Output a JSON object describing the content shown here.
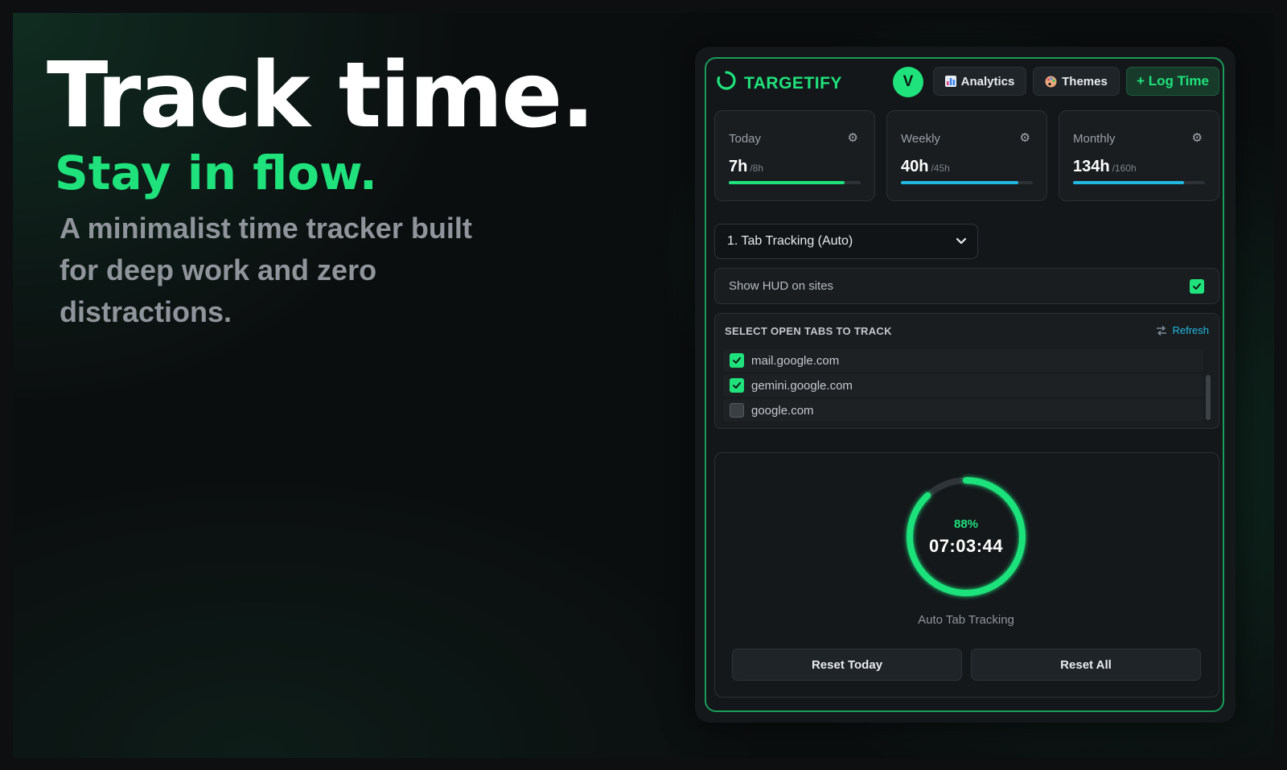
{
  "hero": {
    "title": "Track time.",
    "subtitle": "Stay in flow.",
    "description": "A minimalist time tracker built for deep work and zero distractions."
  },
  "header": {
    "brand": "TARGETIFY",
    "avatar_initial": "V",
    "analytics_label": "Analytics",
    "analytics_icon": "bar-chart-icon",
    "themes_label": "Themes",
    "themes_icon": "palette-icon",
    "log_time_label": "+ Log Time"
  },
  "stats": [
    {
      "label": "Today",
      "value": "7h",
      "goal": "/8h",
      "progress": 0.88,
      "color": "#1fe27c"
    },
    {
      "label": "Weekly",
      "value": "40h",
      "goal": "/45h",
      "progress": 0.89,
      "color": "#22b8e0"
    },
    {
      "label": "Monthly",
      "value": "134h",
      "goal": "/160h",
      "progress": 0.84,
      "color": "#22b8e0"
    }
  ],
  "mode_select": {
    "value": "1. Tab Tracking (Auto)"
  },
  "hud": {
    "label": "Show HUD on sites",
    "checked": true
  },
  "tabs": {
    "title": "SELECT OPEN TABS TO TRACK",
    "refresh_label": "Refresh",
    "items": [
      {
        "domain": "mail.google.com",
        "checked": true
      },
      {
        "domain": "gemini.google.com",
        "checked": true
      },
      {
        "domain": "google.com",
        "checked": false
      }
    ]
  },
  "timer": {
    "percent": "88%",
    "progress": 0.88,
    "time": "07:03:44",
    "mode_label": "Auto Tab Tracking"
  },
  "actions": {
    "reset_today": "Reset Today",
    "reset_all": "Reset All"
  },
  "colors": {
    "accent": "#1fe27c",
    "info": "#22b8e0",
    "panel_border": "#1a9c5a"
  }
}
